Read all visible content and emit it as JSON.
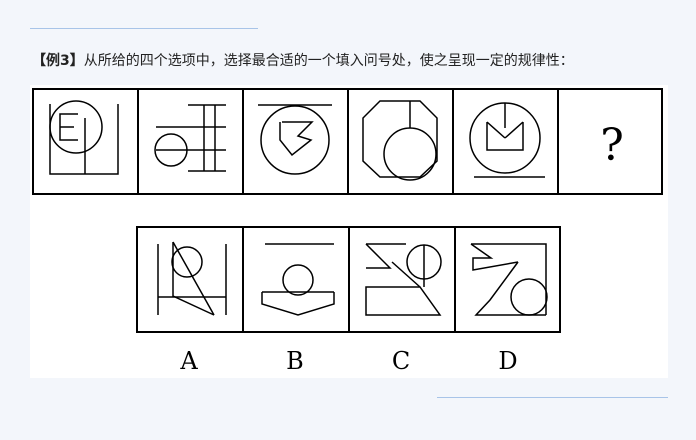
{
  "question": {
    "tag": "【例3】",
    "text": "从所给的四个选项中，选择最合适的一个填入问号处，使之呈现一定的规律性："
  },
  "top_row": {
    "question_mark": "?"
  },
  "options": [
    {
      "label": "A"
    },
    {
      "label": "B"
    },
    {
      "label": "C"
    },
    {
      "label": "D"
    }
  ]
}
